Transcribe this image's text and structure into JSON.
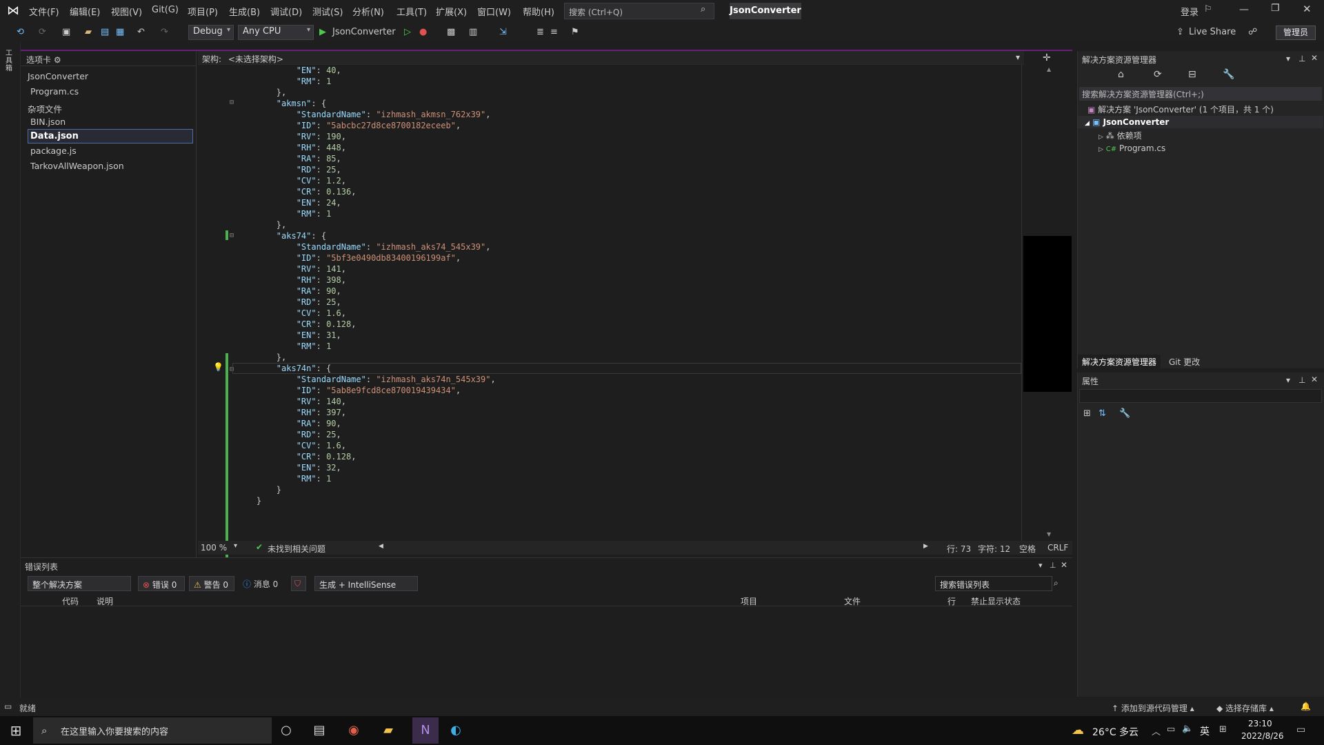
{
  "menu": [
    "文件(F)",
    "编辑(E)",
    "视图(V)",
    "Git(G)",
    "项目(P)",
    "生成(B)",
    "调试(D)",
    "测试(S)",
    "分析(N)",
    "工具(T)",
    "扩展(X)",
    "窗口(W)",
    "帮助(H)"
  ],
  "search_placeholder": "搜索 (Ctrl+Q)",
  "app_name": "JsonConverter",
  "login": "登录",
  "toolbar": {
    "config": "Debug",
    "platform": "Any CPU",
    "start": "JsonConverter",
    "live_share": "Live Share",
    "admin": "管理员"
  },
  "tabs_pane": {
    "title": "选项卡",
    "project": "JsonConverter",
    "program": "Program.cs",
    "misc": "杂项文件",
    "files": [
      "BIN.json",
      "Data.json",
      "package.js",
      "TarkovAllWeapon.json"
    ]
  },
  "editor": {
    "arch_label": "架构:",
    "arch_value": "<未选择架构>",
    "lines": [
      "            \"EN\": 40,",
      "            \"RM\": 1",
      "        },",
      "        \"akmsn\": {",
      "            \"StandardName\": \"izhmash_akmsn_762x39\",",
      "            \"ID\": \"5abcbc27d8ce8700182eceeb\",",
      "            \"RV\": 190,",
      "            \"RH\": 448,",
      "            \"RA\": 85,",
      "            \"RD\": 25,",
      "            \"CV\": 1.2,",
      "            \"CR\": 0.136,",
      "            \"EN\": 24,",
      "            \"RM\": 1",
      "        },",
      "        \"aks74\": {",
      "            \"StandardName\": \"izhmash_aks74_545x39\",",
      "            \"ID\": \"5bf3e0490db83400196199af\",",
      "            \"RV\": 141,",
      "            \"RH\": 398,",
      "            \"RA\": 90,",
      "            \"RD\": 25,",
      "            \"CV\": 1.6,",
      "            \"CR\": 0.128,",
      "            \"EN\": 31,",
      "            \"RM\": 1",
      "        },",
      "        \"aks74n\": {",
      "            \"StandardName\": \"izhmash_aks74n_545x39\",",
      "            \"ID\": \"5ab8e9fcd8ce870019439434\",",
      "            \"RV\": 140,",
      "            \"RH\": 397,",
      "            \"RA\": 90,",
      "            \"RD\": 25,",
      "            \"CV\": 1.6,",
      "            \"CR\": 0.128,",
      "            \"EN\": 32,",
      "            \"RM\": 1",
      "        }",
      "    }"
    ]
  },
  "editor_status": {
    "zoom": "100 %",
    "issues": "未找到相关问题",
    "line": "行: 73",
    "col": "字符: 12",
    "spaces": "空格",
    "eol": "CRLF"
  },
  "error_list": {
    "title": "错误列表",
    "scope": "整个解决方案",
    "errors": "错误 0",
    "warnings": "警告 0",
    "messages": "消息 0",
    "build": "生成 + IntelliSense",
    "search": "搜索错误列表",
    "cols": [
      "代码",
      "说明",
      "项目",
      "文件",
      "行",
      "禁止显示状态"
    ]
  },
  "solution": {
    "title": "解决方案资源管理器",
    "search": "搜索解决方案资源管理器(Ctrl+;)",
    "root": "解决方案 'JsonConverter' (1 个项目，共 1 个)",
    "project": "JsonConverter",
    "deps": "依赖项",
    "program": "Program.cs",
    "tab1": "解决方案资源管理器",
    "tab2": "Git 更改"
  },
  "properties": {
    "title": "属性"
  },
  "status": {
    "ready": "就绪",
    "source": "添加到源代码管理",
    "repo": "选择存储库"
  },
  "taskbar": {
    "search": "在这里输入你要搜索的内容",
    "weather": "26°C 多云",
    "lang": "英",
    "time": "23:10",
    "date": "2022/8/26"
  },
  "colors": {
    "accent": "#68217a",
    "key": "#9cdcfe",
    "string": "#ce9178",
    "number": "#b5cea8",
    "change": "#4caf50"
  }
}
